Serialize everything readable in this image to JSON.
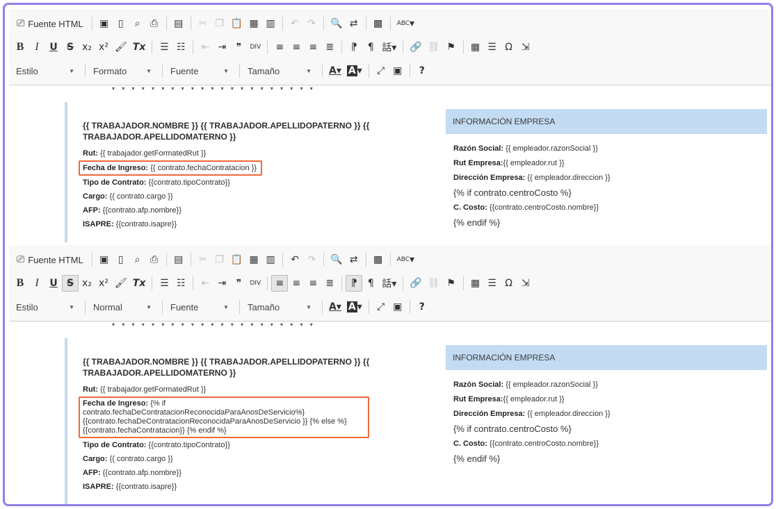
{
  "toolbar": {
    "source_label": "Fuente HTML",
    "combos": {
      "estilo": "Estilo",
      "formato_top": "Formato",
      "formato_bottom": "Normal",
      "fuente": "Fuente",
      "tamano": "Tamaño"
    },
    "glyphs": {
      "bold": "B",
      "italic": "I",
      "underline": "U",
      "strike": "S",
      "subscript": "x₂",
      "superscript": "x²",
      "clear_format": "Tx",
      "quote": "❞",
      "div": "DIV",
      "omega": "Ω",
      "help": "?",
      "font_color": "A",
      "bg_color": "A",
      "spell": "ABC"
    }
  },
  "colors": {
    "frame": "#8f7fe6",
    "highlight": "#f0683a",
    "company_header": "#c3dcf3",
    "left_border": "#c6daf0"
  },
  "document": {
    "worker_name": "{{ TRABAJADOR.NOMBRE }} {{ TRABAJADOR.APELLIDOPATERNO }} {{ TRABAJADOR.APELLIDOMATERNO }}",
    "rut_label": "Rut:",
    "rut_value": "{{ trabajador.getFormatedRut }}",
    "ingreso_label": "Fecha de Ingreso:",
    "ingreso_value_old": "{{ contrato.fechaContratacion }}",
    "ingreso_value_new": "{% if contrato.fechaDeContratacionReconocidaParaAnosDeServicio%} {{contrato.fechaDeContratacionReconocidaParaAnosDeServicio }} {% else %} {{contrato.fechaContratacion}} {% endif %}",
    "tipo_label": "Tipo de Contrato:",
    "tipo_value": "{{contrato.tipoContrato}}",
    "cargo_label": "Cargo:",
    "cargo_value": "{{ contrato.cargo }}",
    "afp_label": "AFP:",
    "afp_value": "{{contrato.afp.nombre}}",
    "isapre_label": "ISAPRE:",
    "isapre_value": "{{contrato.isapre}}",
    "company_header": "INFORMACIÓN EMPRESA",
    "razon_label": "Razón Social:",
    "razon_value": "{{ empleador.razonSocial }}",
    "rut_empresa_label": "Rut Empresa:",
    "rut_empresa_value": "{{ empleador.rut }}",
    "direccion_label": "Dirección Empresa:",
    "direccion_value": "{{ empleador.direccion }}",
    "if_centro": "{% if contrato.centroCosto %}",
    "ccosto_label": "C. Costo:",
    "ccosto_value": "{{contrato.centroCosto.nombre}}",
    "endif": "{% endif %}"
  }
}
